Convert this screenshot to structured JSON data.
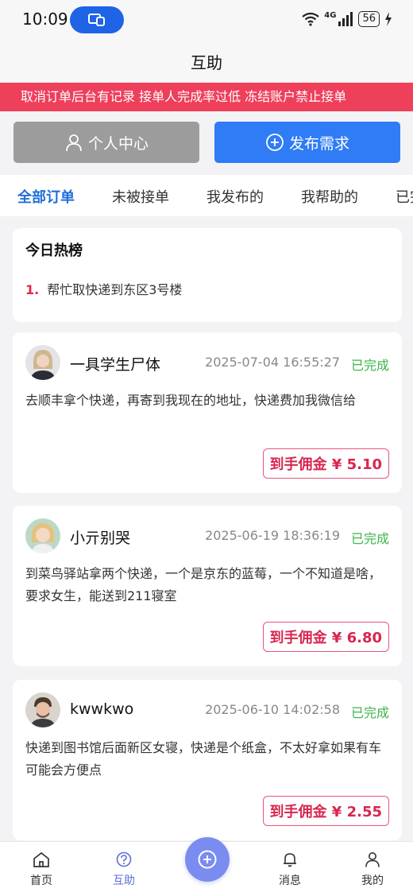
{
  "status_bar": {
    "time": "10:09",
    "network": "4G",
    "battery": "56"
  },
  "header": {
    "title": "互助"
  },
  "notice": {
    "text": "取消订单后台有记录 接单人完成率过低 冻结账户禁止接单"
  },
  "actions": {
    "personal_center": "个人中心",
    "publish": "发布需求"
  },
  "tabs": [
    {
      "label": "全部订单",
      "active": true
    },
    {
      "label": "未被接单",
      "active": false
    },
    {
      "label": "我发布的",
      "active": false
    },
    {
      "label": "我帮助的",
      "active": false
    },
    {
      "label": "已完成",
      "active": false
    }
  ],
  "hot_list": {
    "title": "今日热榜",
    "items": [
      {
        "rank": "1.",
        "text": "帮忙取快递到东区3号楼"
      }
    ]
  },
  "orders": [
    {
      "user": "一具学生尸体",
      "time": "2025-07-04 16:55:27",
      "status": "已完成",
      "content": "去顺丰拿个快递，再寄到我现在的地址，快递费加我微信给",
      "commission": "到手佣金 ¥ 5.10"
    },
    {
      "user": "小亓别哭",
      "time": "2025-06-19 18:36:19",
      "status": "已完成",
      "content": "到菜鸟驿站拿两个快递，一个是京东的蓝莓，一个不知道是啥，要求女生，能送到211寝室",
      "commission": "到手佣金 ¥ 6.80"
    },
    {
      "user": "kwwkwo",
      "time": "2025-06-10 14:02:58",
      "status": "已完成",
      "content": "快递到图书馆后面新区女寝，快递是个纸盒，不太好拿如果有车可能会方便点",
      "commission": "到手佣金 ¥ 2.55"
    }
  ],
  "bottom_nav": {
    "home": "首页",
    "mutual_aid": "互助",
    "messages": "消息",
    "mine": "我的"
  },
  "colors": {
    "accent_blue": "#2f7cf6",
    "notice_red": "#ee3f5b",
    "status_green": "#3cb54a",
    "commission_red": "#d8264f",
    "nav_active": "#5f6fd3"
  }
}
